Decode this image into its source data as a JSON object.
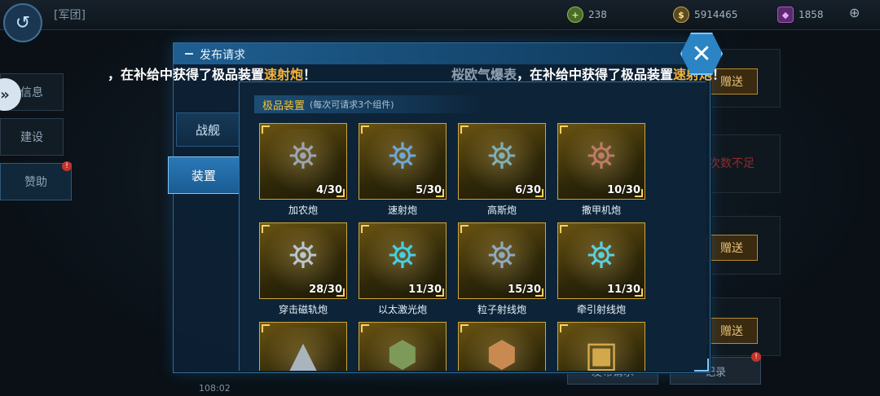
{
  "topbar": {
    "back_icon": "back-arrow-icon",
    "title": "[军团]",
    "resources": [
      {
        "icon": "crosshair-icon",
        "value": "238"
      },
      {
        "icon": "coin-icon",
        "value": "5914465"
      },
      {
        "icon": "purple-crystal-icon",
        "value": "1858"
      }
    ],
    "plus_icon": "plus-icon"
  },
  "sidebar": {
    "items": [
      {
        "label": "信息"
      },
      {
        "label": "建设"
      },
      {
        "label": "赞助"
      }
    ]
  },
  "background": {
    "gift_label": "赠送",
    "insufficient_label": "次数不足",
    "bottom_button_1": "发布请求",
    "bottom_button_2": "记录",
    "timer": "108:02"
  },
  "ticker": {
    "msg1_prefix": "，在补给中获得了极品装置",
    "msg1_item": "速射炮",
    "msg1_suffix": "！",
    "msg2_name": "桜欧气爆表",
    "msg2_prefix": "，在补给中获得了极品装置",
    "msg2_item": "速射炮",
    "msg2_suffix": "！"
  },
  "modal": {
    "title": "发布请求",
    "close_icon": "close-icon",
    "tabs": [
      {
        "label": "战舰",
        "active": false
      },
      {
        "label": "装置",
        "active": true
      }
    ],
    "section_title": "极品装置",
    "section_note": "(每次可请求3个组件)",
    "items": [
      {
        "name": "加农炮",
        "count": "4/30",
        "icon": "cannon-icon"
      },
      {
        "name": "速射炮",
        "count": "5/30",
        "icon": "rapid-fire-gun-icon"
      },
      {
        "name": "高斯炮",
        "count": "6/30",
        "icon": "gauss-cannon-icon"
      },
      {
        "name": "撒甲机炮",
        "count": "10/30",
        "icon": "machine-cannon-icon"
      },
      {
        "name": "穿击磁轨炮",
        "count": "28/30",
        "icon": "railgun-icon"
      },
      {
        "name": "以太激光炮",
        "count": "11/30",
        "icon": "laser-cannon-icon"
      },
      {
        "name": "粒子射线炮",
        "count": "15/30",
        "icon": "particle-beam-icon"
      },
      {
        "name": "牵引射线炮",
        "count": "11/30",
        "icon": "tractor-beam-icon"
      },
      {
        "name": "",
        "count": "",
        "icon": "spike-device-icon"
      },
      {
        "name": "",
        "count": "",
        "icon": "armor-module-icon"
      },
      {
        "name": "",
        "count": "",
        "icon": "engine-module-icon"
      },
      {
        "name": "",
        "count": "",
        "icon": "crate-module-icon"
      }
    ]
  }
}
